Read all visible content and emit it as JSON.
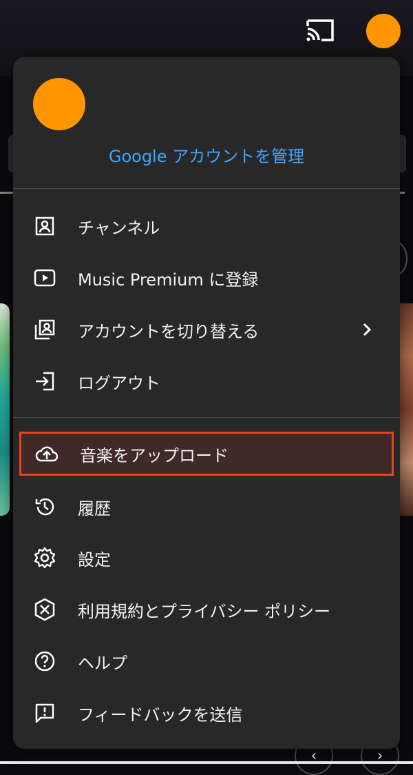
{
  "header": {
    "cast_icon": "cast-icon",
    "avatar_color": "#ff9500"
  },
  "menu": {
    "avatar_color": "#ff9500",
    "manage_account": "Google アカウントを管理",
    "items": [
      {
        "icon": "channel-icon",
        "label": "チャンネル"
      },
      {
        "icon": "premium-icon",
        "label": "Music Premium に登録"
      },
      {
        "icon": "switch-account-icon",
        "label": "アカウントを切り替える"
      },
      {
        "icon": "logout-icon",
        "label": "ログアウト"
      },
      {
        "icon": "upload-cloud-icon",
        "label": "音楽をアップロード"
      },
      {
        "icon": "history-icon",
        "label": "履歴"
      },
      {
        "icon": "settings-icon",
        "label": "設定"
      },
      {
        "icon": "terms-privacy-icon",
        "label": "利用規約とプライバシー ポリシー"
      },
      {
        "icon": "help-icon",
        "label": "ヘルプ"
      },
      {
        "icon": "feedback-icon",
        "label": "フィードバックを送信"
      }
    ]
  },
  "colors": {
    "accent_link": "#3ea6ff",
    "menu_bg": "#282828",
    "highlight_border": "#e8421f",
    "highlight_bg": "#402a27"
  },
  "background": {
    "nav_prev": "‹",
    "nav_next": "›"
  }
}
